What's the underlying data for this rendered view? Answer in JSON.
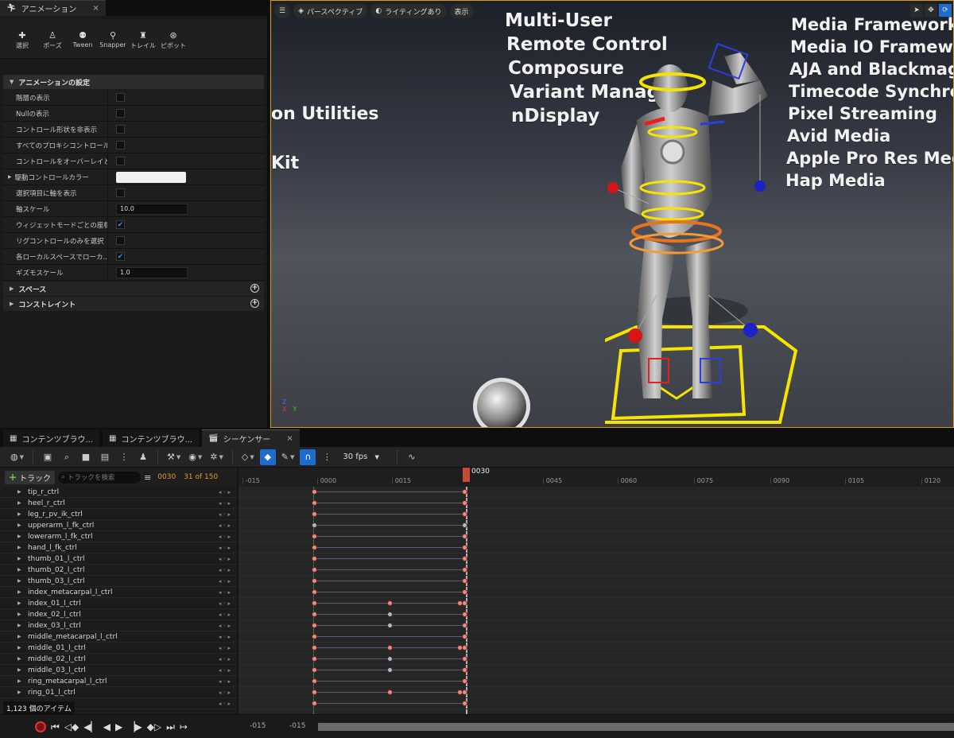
{
  "anim_panel": {
    "tab_title": "アニメーション",
    "tab_close": "×",
    "modes": [
      {
        "label": "選択",
        "icon": "select-icon"
      },
      {
        "label": "ポーズ",
        "icon": "pose-icon"
      },
      {
        "label": "Tween",
        "icon": "tween-icon"
      },
      {
        "label": "Snapper",
        "icon": "snapper-icon"
      },
      {
        "label": "トレイル",
        "icon": "trail-icon"
      },
      {
        "label": "ピボット",
        "icon": "pivot-icon"
      }
    ],
    "section_title": "アニメーションの設定",
    "props": [
      {
        "label": "階層の表示",
        "type": "checkbox",
        "checked": false
      },
      {
        "label": "Nullの表示",
        "type": "checkbox",
        "checked": false
      },
      {
        "label": "コントロール形状を非表示",
        "type": "checkbox",
        "checked": false
      },
      {
        "label": "すべてのプロキシコントロール...",
        "type": "checkbox",
        "checked": false
      },
      {
        "label": "コントロールをオーバーレイと...",
        "type": "checkbox",
        "checked": false
      },
      {
        "label": "駆動コントロールカラー",
        "type": "color",
        "expandable": true
      },
      {
        "label": "選択項目に軸を表示",
        "type": "checkbox",
        "checked": false
      },
      {
        "label": "軸スケール",
        "type": "number",
        "value": "10.0"
      },
      {
        "label": "ウィジェットモードごとの座標系",
        "type": "checkbox",
        "checked": true
      },
      {
        "label": "リグコントロールのみを選択",
        "type": "checkbox",
        "checked": false
      },
      {
        "label": "各ローカルスペースでローカ...",
        "type": "checkbox",
        "checked": true
      },
      {
        "label": "ギズモスケール",
        "type": "number",
        "value": "1.0"
      }
    ],
    "subsections": [
      "スペース",
      "コンストレイント"
    ]
  },
  "viewport": {
    "toolbar": {
      "perspective": "パースペクティブ",
      "lighting": "ライティングあり",
      "show": "表示"
    },
    "world_text_center": [
      "Multi-User",
      "Remote Control",
      "Composure",
      "Variant Manager",
      "nDisplay"
    ],
    "world_text_right": [
      "Media Framework U",
      "Media IO Framework",
      "AJA and Blackmagic",
      "Timecode Synchroniz",
      "Pixel Streaming",
      "Avid Media",
      "Apple Pro Res Media",
      "Hap Media"
    ],
    "world_text_left": [
      "on Utilities",
      "Kit"
    ],
    "axis": {
      "z": "Z",
      "x": "X",
      "y": "Y"
    },
    "colors": {
      "border": "#d99a1e",
      "selection_yellow": "#f5e400"
    }
  },
  "bottom_tabs": [
    {
      "label": "コンテンツブラウ...",
      "icon": "content-browser-icon"
    },
    {
      "label": "コンテンツブラウ...",
      "icon": "content-browser-icon"
    },
    {
      "label": "シーケンサー",
      "icon": "sequencer-icon",
      "close": "×"
    }
  ],
  "seq_toolbar": {
    "fps": "30 fps"
  },
  "track_head": {
    "add_track": "トラック",
    "search_placeholder": "トラックを検索",
    "current_frame": "0030",
    "frame_count": "31 of 150"
  },
  "tracks": [
    {
      "name": "tip_r_ctrl",
      "keys": [
        0,
        30
      ],
      "mid": []
    },
    {
      "name": "heel_r_ctrl",
      "keys": [
        0,
        30
      ],
      "mid": []
    },
    {
      "name": "leg_r_pv_ik_ctrl",
      "keys": [
        0,
        30
      ],
      "mid": []
    },
    {
      "name": "upperarm_l_fk_ctrl",
      "keys": [
        0,
        30
      ],
      "mid": [],
      "gray": true
    },
    {
      "name": "lowerarm_l_fk_ctrl",
      "keys": [
        0,
        30
      ],
      "mid": []
    },
    {
      "name": "hand_l_fk_ctrl",
      "keys": [
        0,
        30
      ],
      "mid": []
    },
    {
      "name": "thumb_01_l_ctrl",
      "keys": [
        0,
        30
      ],
      "mid": []
    },
    {
      "name": "thumb_02_l_ctrl",
      "keys": [
        0,
        30
      ],
      "mid": []
    },
    {
      "name": "thumb_03_l_ctrl",
      "keys": [
        0,
        30
      ],
      "mid": []
    },
    {
      "name": "index_metacarpal_l_ctrl",
      "keys": [
        0,
        30
      ],
      "mid": []
    },
    {
      "name": "index_01_l_ctrl",
      "keys": [
        0,
        30
      ],
      "mid": [
        15,
        29
      ]
    },
    {
      "name": "index_02_l_ctrl",
      "keys": [
        0,
        30
      ],
      "mid": [
        15
      ],
      "midgray": true
    },
    {
      "name": "index_03_l_ctrl",
      "keys": [
        0,
        30
      ],
      "mid": [
        15
      ],
      "midgray": true
    },
    {
      "name": "middle_metacarpal_l_ctrl",
      "keys": [
        0,
        30
      ],
      "mid": []
    },
    {
      "name": "middle_01_l_ctrl",
      "keys": [
        0,
        30
      ],
      "mid": [
        15,
        29
      ]
    },
    {
      "name": "middle_02_l_ctrl",
      "keys": [
        0,
        30
      ],
      "mid": [
        15
      ],
      "midgray": true
    },
    {
      "name": "middle_03_l_ctrl",
      "keys": [
        0,
        30
      ],
      "mid": [
        15
      ],
      "midgray": true
    },
    {
      "name": "ring_metacarpal_l_ctrl",
      "keys": [
        0,
        30
      ],
      "mid": []
    },
    {
      "name": "ring_01_l_ctrl",
      "keys": [
        0,
        30
      ],
      "mid": [
        15,
        29
      ]
    },
    {
      "name": "",
      "keys": [
        0,
        30
      ],
      "mid": []
    }
  ],
  "items_count": "1,123 個のアイテム",
  "ruler": {
    "ticks": [
      "-015",
      "0000",
      "0015",
      "0045",
      "0060",
      "0075",
      "0090",
      "0105",
      "0120"
    ],
    "playhead_label": "0030"
  },
  "transport": {
    "start": "-015",
    "end": "-015"
  }
}
